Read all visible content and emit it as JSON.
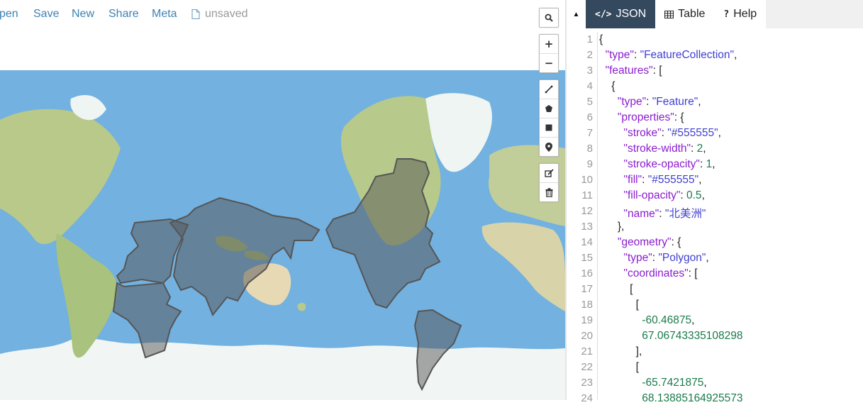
{
  "menu": {
    "items": [
      "pen",
      "Save",
      "New",
      "Share",
      "Meta"
    ],
    "file_status": "unsaved"
  },
  "map_controls": {
    "search": "search-icon",
    "zoom_in": "+",
    "zoom_out": "−",
    "draw_tools": [
      "line-icon",
      "polygon-icon",
      "rectangle-icon",
      "marker-icon"
    ],
    "edit_tools": [
      "edit-icon",
      "trash-icon"
    ]
  },
  "tabs": {
    "collapse": "▲",
    "json": "JSON",
    "json_icon": "</>",
    "table": "Table",
    "help": "Help",
    "help_icon": "?"
  },
  "editor": {
    "line_numbers": [
      "1",
      "2",
      "3",
      "4",
      "5",
      "6",
      "7",
      "8",
      "9",
      "10",
      "11",
      "12",
      "13",
      "14",
      "15",
      "16",
      "17",
      "18",
      "19",
      "20",
      "21",
      "22",
      "23",
      "24"
    ],
    "lines": [
      "{",
      "  \"type\": \"FeatureCollection\",",
      "  \"features\": [",
      "    {",
      "      \"type\": \"Feature\",",
      "      \"properties\": {",
      "        \"stroke\": \"#555555\",",
      "        \"stroke-width\": 2,",
      "        \"stroke-opacity\": 1,",
      "        \"fill\": \"#555555\",",
      "        \"fill-opacity\": 0.5,",
      "        \"name\": \"北美洲\"",
      "      },",
      "      \"geometry\": {",
      "        \"type\": \"Polygon\",",
      "        \"coordinates\": [",
      "          [",
      "            [",
      "              -60.46875,",
      "              67.06743335108298",
      "            ],",
      "            [",
      "              -65.7421875,",
      "              68.13885164925573"
    ]
  },
  "colors": {
    "ocean": "#72b1e0",
    "polygon_fill": "#555555",
    "active_tab": "#34495e",
    "menu_link": "#3c83b4"
  }
}
